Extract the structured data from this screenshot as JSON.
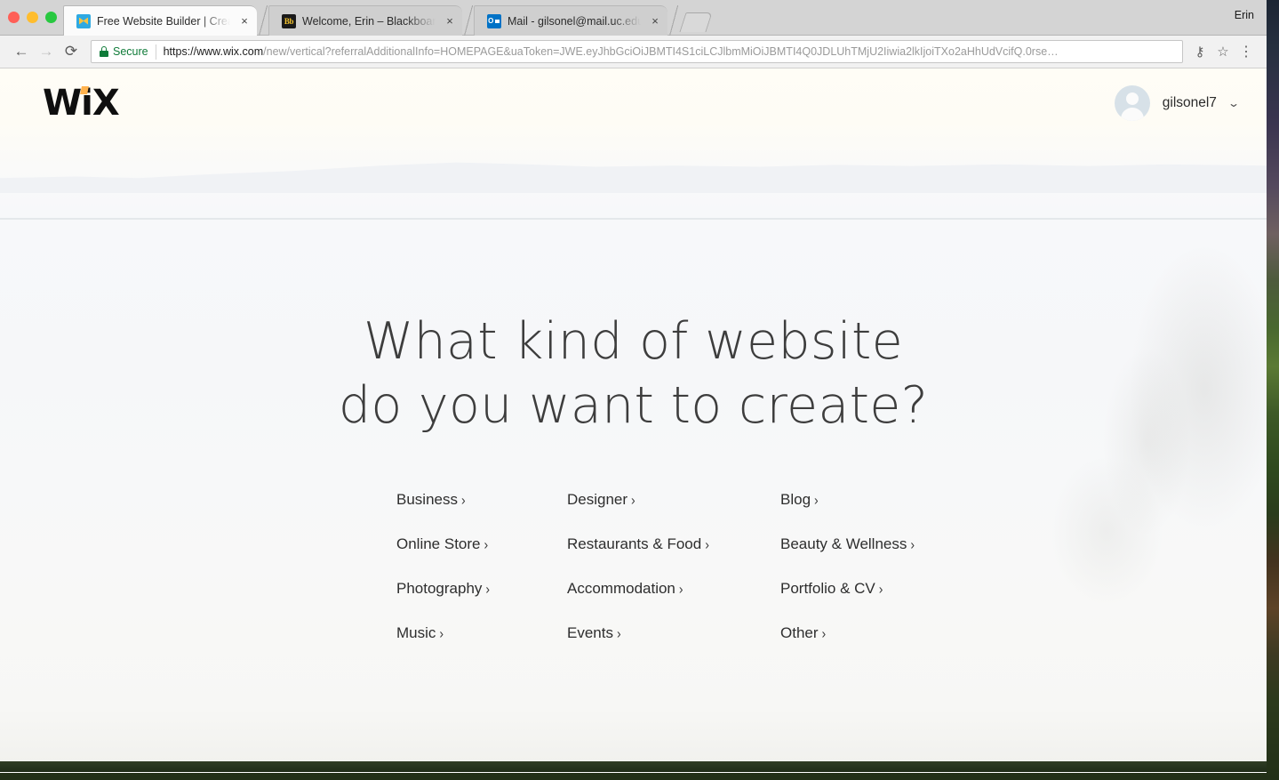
{
  "window": {
    "user_label": "Erin",
    "traffic_lights": [
      "close",
      "minimize",
      "zoom"
    ]
  },
  "tabs": [
    {
      "title": "Free Website Builder | Create a",
      "favicon": "wix-favicon",
      "active": true,
      "close_label": "×"
    },
    {
      "title": "Welcome, Erin – Blackboard Le",
      "favicon": "blackboard-favicon",
      "active": false,
      "close_label": "×"
    },
    {
      "title": "Mail - gilsonel@mail.uc.edu",
      "favicon": "outlook-favicon",
      "active": false,
      "close_label": "×"
    }
  ],
  "toolbar": {
    "back_glyph": "←",
    "forward_glyph": "→",
    "reload_glyph": "⟳",
    "secure_label": "Secure",
    "url_host": "https://www.wix.com",
    "url_path": "/new/vertical?referralAdditionalInfo=HOMEPAGE&uaToken=JWE.eyJhbGciOiJBMTI4S1ciLCJlbmMiOiJBMTI4Q0JDLUhTMjU2Iiwia2lkIjoiTXo2aHhUdVcifQ.0rse…",
    "key_glyph": "⚷",
    "star_glyph": "☆",
    "menu_glyph": "⋮"
  },
  "site": {
    "logo_text": "WiX",
    "account": {
      "name": "gilsonel7",
      "chevron": "⌄"
    }
  },
  "headline": {
    "line1": "What kind of website",
    "line2": "do you want to create?"
  },
  "categories": [
    {
      "label": "Business",
      "chevron": "›"
    },
    {
      "label": "Designer",
      "chevron": "›"
    },
    {
      "label": "Blog",
      "chevron": "›"
    },
    {
      "label": "Online Store",
      "chevron": "›"
    },
    {
      "label": "Restaurants & Food",
      "chevron": "›"
    },
    {
      "label": "Beauty & Wellness",
      "chevron": "›"
    },
    {
      "label": "Photography",
      "chevron": "›"
    },
    {
      "label": "Accommodation",
      "chevron": "›"
    },
    {
      "label": "Portfolio & CV",
      "chevron": "›"
    },
    {
      "label": "Music",
      "chevron": "›"
    },
    {
      "label": "Events",
      "chevron": "›"
    },
    {
      "label": "Other",
      "chevron": "›"
    }
  ],
  "colors": {
    "secure_green": "#0f7b39",
    "wix_accent": "#ffb24d",
    "page_bg": "#fbfbfa"
  }
}
